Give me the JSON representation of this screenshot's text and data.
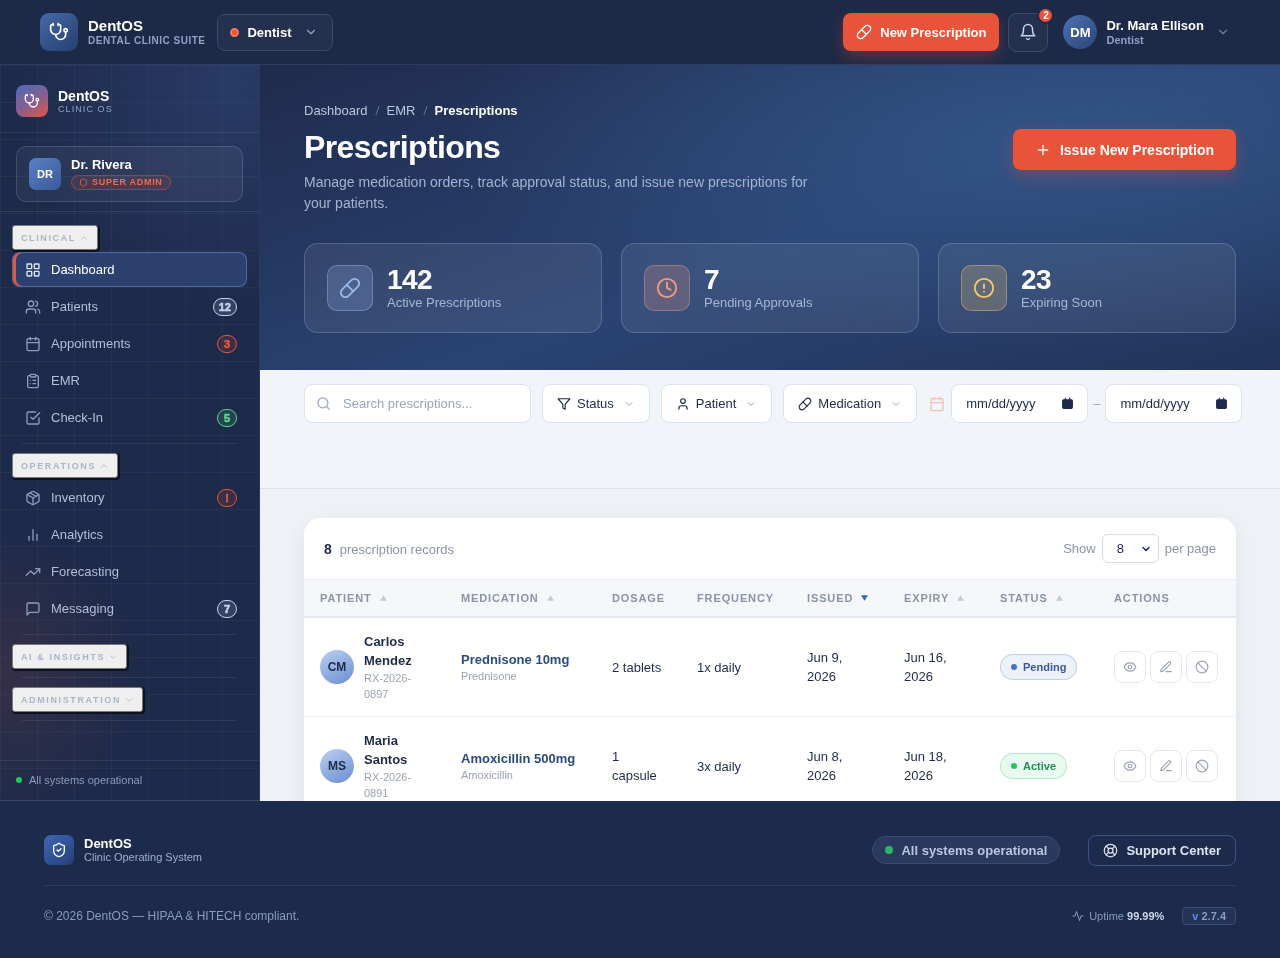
{
  "topbar": {
    "brand": {
      "name": "DentOS",
      "tagline": "DENTAL CLINIC SUITE"
    },
    "role_switch": {
      "label": "Dentist"
    },
    "new_prescription": {
      "label": "New Prescription"
    },
    "notifications": {
      "count": "2"
    },
    "user": {
      "initials": "DM",
      "name": "Dr. Mara Ellison",
      "role": "Dentist"
    }
  },
  "sidebar": {
    "brand": {
      "name": "DentOS",
      "tagline": "CLINIC OS"
    },
    "user": {
      "initials": "DR",
      "name": "Dr. Rivera",
      "badge": "SUPER ADMIN"
    },
    "sections": [
      {
        "title": "CLINICAL",
        "expanded": true,
        "items": [
          {
            "label": "Dashboard",
            "selected": true
          },
          {
            "label": "Patients",
            "selected": false,
            "badge": {
              "text": "12",
              "color": "#c5d3ee"
            }
          },
          {
            "label": "Appointments",
            "selected": false,
            "badge": {
              "text": "3",
              "color": "#e8553d"
            }
          },
          {
            "label": "EMR",
            "selected": false
          },
          {
            "label": "Check-In",
            "selected": false,
            "badge": {
              "text": "5",
              "color": "#5fd38a"
            }
          }
        ]
      },
      {
        "title": "OPERATIONS",
        "expanded": true,
        "items": [
          {
            "label": "Inventory",
            "selected": false,
            "badge": {
              "text": "!",
              "color": "#e8553d"
            }
          },
          {
            "label": "Analytics",
            "selected": false
          },
          {
            "label": "Forecasting",
            "selected": false
          },
          {
            "label": "Messaging",
            "selected": false,
            "badge": {
              "text": "7",
              "color": "#c5d3ee"
            }
          }
        ]
      },
      {
        "title": "AI & INSIGHTS",
        "expanded": false
      },
      {
        "title": "ADMINISTRATION",
        "expanded": false
      }
    ],
    "status": "All systems operational"
  },
  "page": {
    "breadcrumb": [
      {
        "label": "Dashboard",
        "current": false
      },
      {
        "label": "EMR",
        "current": false
      },
      {
        "label": "Prescriptions",
        "current": true
      }
    ],
    "title": "Prescriptions",
    "description": "Manage medication orders, track approval status, and issue new prescriptions for your patients.",
    "primary_action": "Issue New Prescription",
    "stats": [
      {
        "value": "142",
        "label": "Active Prescriptions",
        "color": "#9bb8ee"
      },
      {
        "value": "7",
        "label": "Pending Approvals",
        "color": "#f39a86"
      },
      {
        "value": "23",
        "label": "Expiring Soon",
        "color": "#f6c86e"
      }
    ]
  },
  "filters": {
    "search": {
      "placeholder": "Search prescriptions..."
    },
    "dropdowns": [
      {
        "label": "Status"
      },
      {
        "label": "Patient"
      },
      {
        "label": "Medication"
      }
    ],
    "date_from": {
      "placeholder": "mm/dd/yyyy"
    },
    "date_separator": "–",
    "date_to": {
      "placeholder": "mm/dd/yyyy"
    }
  },
  "table": {
    "count": "8",
    "count_label": "prescription records",
    "page_size": {
      "prefix": "Show",
      "value": "8",
      "suffix": "per page"
    },
    "columns": [
      {
        "label": "PATIENT",
        "sorted": false,
        "descending": false
      },
      {
        "label": "MEDICATION",
        "sorted": false,
        "descending": false
      },
      {
        "label": "DOSAGE"
      },
      {
        "label": "FREQUENCY"
      },
      {
        "label": "ISSUED",
        "sorted": true,
        "descending": true
      },
      {
        "label": "EXPIRY",
        "sorted": false,
        "descending": false
      },
      {
        "label": "STATUS",
        "sorted": false,
        "descending": false
      },
      {
        "label": "ACTIONS"
      }
    ],
    "rows": [
      {
        "initials": "CM",
        "patient": "Carlos Mendez",
        "rx": "RX-2026-0897",
        "medication": "Prednisone 10mg",
        "generic": "Prednisone",
        "dosage": "2 tablets",
        "frequency": "1x daily",
        "issued": "Jun 9, 2026",
        "expiry": "Jun 16, 2026",
        "status": {
          "label": "Pending",
          "color": "#4a72c4"
        }
      },
      {
        "initials": "MS",
        "patient": "Maria Santos",
        "rx": "RX-2026-0891",
        "medication": "Amoxicillin 500mg",
        "generic": "Amoxicillin",
        "dosage": "1 capsule",
        "frequency": "3x daily",
        "issued": "Jun 8, 2026",
        "expiry": "Jun 18, 2026",
        "status": {
          "label": "Active",
          "color": "#22c55e"
        }
      }
    ]
  },
  "footer": {
    "brand": {
      "name": "DentOS",
      "tagline": "Clinic Operating System"
    },
    "system_status": "All systems operational",
    "support": "Support Center",
    "copyright": "© 2026 DentOS — HIPAA & HITECH compliant.",
    "uptime": "Uptime **99.99%**",
    "version": {
      "prefix": "v",
      "number": "2.7.4"
    }
  }
}
